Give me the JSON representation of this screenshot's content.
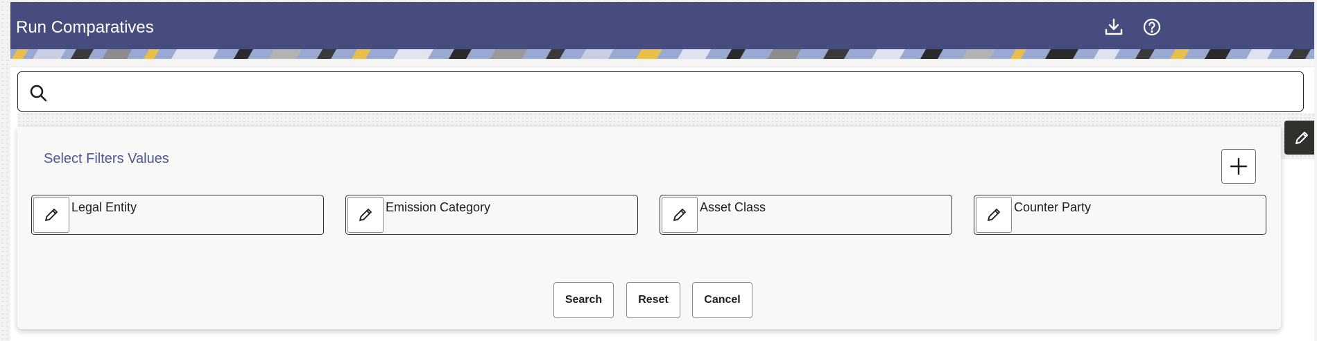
{
  "header": {
    "title": "Run Comparatives",
    "icons": [
      "download-icon",
      "help-icon"
    ]
  },
  "search": {
    "value": "",
    "placeholder": ""
  },
  "filters_panel": {
    "title": "Select Filters Values",
    "filters": [
      {
        "label": "Legal Entity"
      },
      {
        "label": "Emission Category"
      },
      {
        "label": "Asset Class"
      },
      {
        "label": "Counter Party"
      }
    ],
    "buttons": {
      "search": "Search",
      "reset": "Reset",
      "cancel": "Cancel"
    }
  },
  "colors": {
    "header_bg": "#464c7d",
    "panel_title": "#4a5592",
    "panel_bg": "#f9f8f7",
    "dark_button": "#31302d"
  }
}
